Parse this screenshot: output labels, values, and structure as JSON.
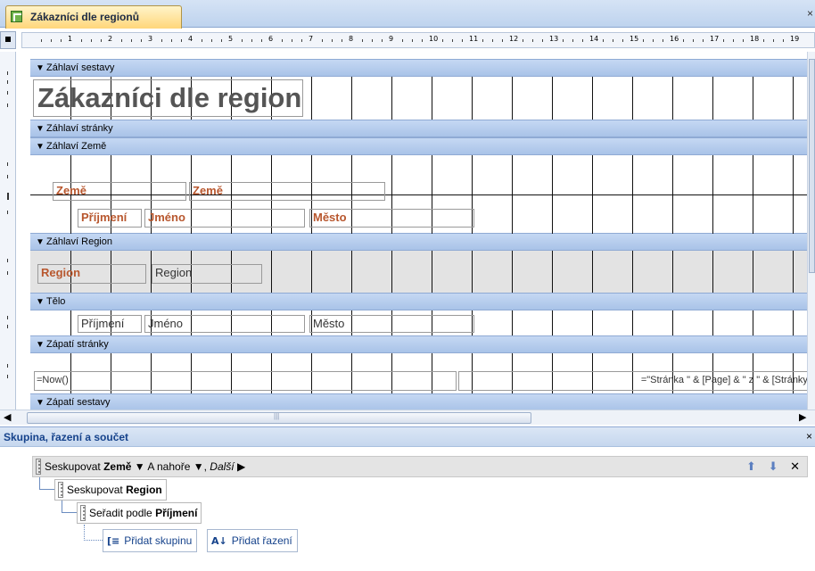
{
  "tab": {
    "title": "Zákazníci dle regionů",
    "close": "×"
  },
  "ruler": {
    "numbers": [
      "1",
      "2",
      "3",
      "4",
      "5",
      "6",
      "7",
      "8",
      "9",
      "10",
      "11",
      "12",
      "13",
      "14",
      "15",
      "16",
      "17",
      "18",
      "19"
    ]
  },
  "bands": {
    "report_header": "Záhlaví sestavy",
    "page_header": "Záhlaví stránky",
    "country_header": "Záhlaví Země",
    "region_header": "Záhlaví Region",
    "detail": "Tělo",
    "page_footer": "Zápatí stránky",
    "report_footer": "Zápatí sestavy",
    "arrow": "🡇"
  },
  "controls": {
    "title": "Zákazníci dle regionů",
    "country_label": "Země",
    "country_field": "Země",
    "surname_label": "Příjmení",
    "name_label": "Jméno",
    "city_label": "Město",
    "region_label": "Region",
    "region_field": "Region",
    "surname_field": "Příjmení",
    "name_field": "Jméno",
    "city_field": "Město",
    "now_field": "=Now()",
    "page_field": "=\"Stránka \" & [Page] & \" z \" & [Stránky]"
  },
  "group_pane": {
    "title": "Skupina, řazení a součet",
    "close": "×",
    "row1": {
      "prefix": "Seskupovat",
      "field": "Země",
      "order": "A nahoře",
      "more": "Další"
    },
    "row2": {
      "prefix": "Seskupovat",
      "field": "Region"
    },
    "row3": {
      "prefix": "Seřadit podle",
      "field": "Příjmení"
    },
    "add_group": "Přidat skupinu",
    "add_sort": "Přidat řazení"
  }
}
